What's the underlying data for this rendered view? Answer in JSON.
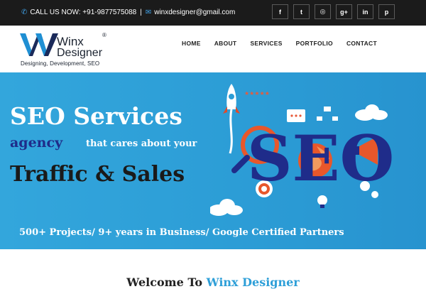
{
  "topbar": {
    "phone_label": "CALL US NOW: +91-9877575088",
    "separator": "|",
    "email": "winxdesigner@gmail.com",
    "socials": [
      {
        "icon": "facebook-icon",
        "glyph": "f"
      },
      {
        "icon": "twitter-icon",
        "glyph": "t"
      },
      {
        "icon": "instagram-icon",
        "glyph": "◎"
      },
      {
        "icon": "google-plus-icon",
        "glyph": "g+"
      },
      {
        "icon": "linkedin-icon",
        "glyph": "in"
      },
      {
        "icon": "pinterest-icon",
        "glyph": "p"
      }
    ]
  },
  "logo": {
    "name_top": "Winx",
    "registered": "®",
    "name_bottom": "Designer",
    "tagline": "Designing, Development, SEO"
  },
  "nav": [
    "HOME",
    "ABOUT",
    "SERVICES",
    "PORTFOLIO",
    "CONTACT"
  ],
  "banner": {
    "line1": "SEO Services",
    "agency": "agency",
    "cares": "that cares about your",
    "line3": "Traffic & Sales",
    "seo_art": "SEO",
    "bottom": "500+ Projects/ 9+ years in Business/ Google Certified Partners"
  },
  "welcome": {
    "prefix": "Welcome To ",
    "accent": "Winx Designer"
  },
  "colors": {
    "topbar_bg": "#1b1b1b",
    "accent_blue": "#2e9fd8",
    "banner_bg": "#2c9dd6",
    "agency_navy": "#1f2c8a"
  }
}
